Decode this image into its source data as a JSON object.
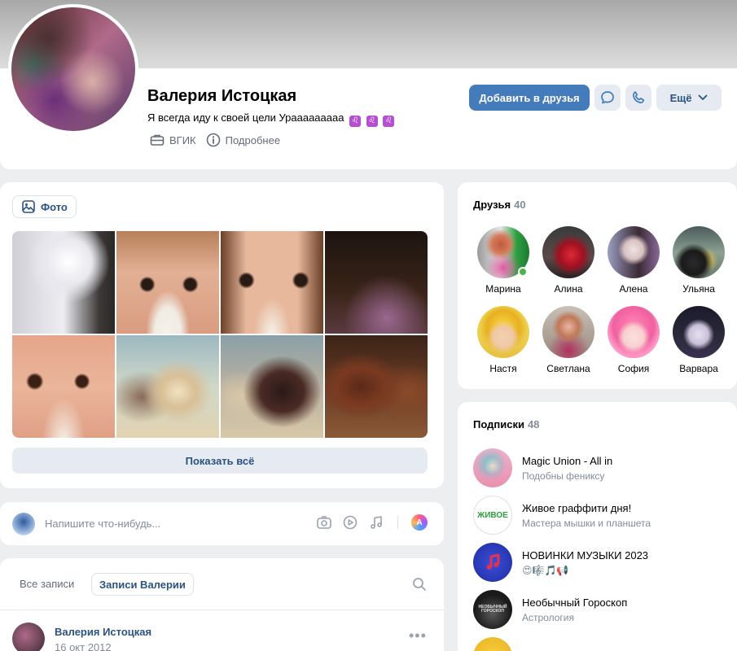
{
  "profile": {
    "name": "Валерия Истоцкая",
    "status": "Я всегда иду к своей цели Урааааааааа",
    "status_emoji": [
      "♌",
      "♌",
      "♌"
    ],
    "education": "ВГИК",
    "details_link": "Подробнее",
    "add_friend": "Добавить в друзья",
    "more": "Ещё"
  },
  "photos": {
    "tab_label": "Фото",
    "show_all": "Показать всё"
  },
  "composer": {
    "placeholder": "Напишите что-нибудь...",
    "ai_label": "A"
  },
  "wall": {
    "tab_all": "Все записи",
    "tab_own": "Записи Валерии",
    "post": {
      "author": "Валерия Истоцкая",
      "date": "16 окт 2012",
      "more": "•••"
    }
  },
  "friends": {
    "title": "Друзья",
    "count": "40",
    "items": [
      {
        "name": "Марина",
        "online": true
      },
      {
        "name": "Алина",
        "online": false
      },
      {
        "name": "Алена",
        "online": false
      },
      {
        "name": "Ульяна",
        "online": false
      },
      {
        "name": "Настя",
        "online": false
      },
      {
        "name": "Светлана",
        "online": false
      },
      {
        "name": "София",
        "online": false
      },
      {
        "name": "Варвара",
        "online": false
      }
    ]
  },
  "subscriptions": {
    "title": "Подписки",
    "count": "48",
    "items": [
      {
        "title": "Magic Union - All in",
        "desc": "Подобны фениксу"
      },
      {
        "title": "Живое граффити дня!",
        "desc": "Мастера мышки и планшета",
        "logo_text": "ЖИВОЕ"
      },
      {
        "title": "НОВИНКИ МУЗЫКИ 2023",
        "desc": "😍🎼🎵📢"
      },
      {
        "title": "Необычный Гороскоп",
        "desc": "Астрология",
        "logo_text": "НЕОБЫЧНЫЙ ГОРОСКОП"
      }
    ]
  }
}
